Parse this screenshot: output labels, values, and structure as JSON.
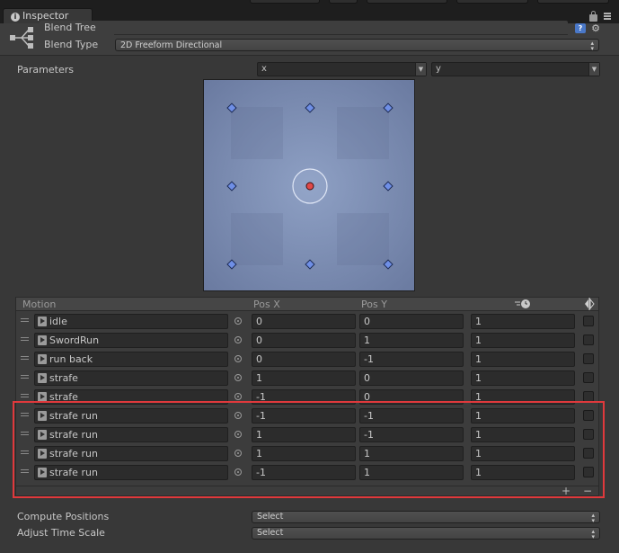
{
  "tab": {
    "title": "Inspector"
  },
  "header": {
    "name_value": "Blend Tree",
    "blend_type_label": "Blend Type",
    "blend_type_value": "2D Freeform Directional"
  },
  "parameters": {
    "label": "Parameters",
    "x_param": "x",
    "y_param": "y"
  },
  "graph": {
    "background": "#7b8aad",
    "points": [
      {
        "x": -1,
        "y": 1
      },
      {
        "x": 0,
        "y": 1
      },
      {
        "x": 1,
        "y": 1
      },
      {
        "x": -1,
        "y": 0
      },
      {
        "x": 1,
        "y": 0
      },
      {
        "x": -1,
        "y": -1
      },
      {
        "x": 0,
        "y": -1
      },
      {
        "x": 1,
        "y": -1
      }
    ],
    "center_point": {
      "x": 0,
      "y": 0
    },
    "point_color": "#6f8fe6",
    "center_color": "#e04848"
  },
  "table": {
    "headers": {
      "motion": "Motion",
      "pos_x": "Pos X",
      "pos_y": "Pos Y"
    },
    "header_icons": {
      "speed": "timescale-icon",
      "mirror": "mirror-icon"
    },
    "rows": [
      {
        "motion": "idle",
        "pos_x": "0",
        "pos_y": "0",
        "speed": "1"
      },
      {
        "motion": "SwordRun",
        "pos_x": "0",
        "pos_y": "1",
        "speed": "1"
      },
      {
        "motion": "run back",
        "pos_x": "0",
        "pos_y": "-1",
        "speed": "1"
      },
      {
        "motion": "strafe",
        "pos_x": "1",
        "pos_y": "0",
        "speed": "1"
      },
      {
        "motion": "strafe",
        "pos_x": "-1",
        "pos_y": "0",
        "speed": "1"
      },
      {
        "motion": "strafe run",
        "pos_x": "-1",
        "pos_y": "-1",
        "speed": "1"
      },
      {
        "motion": "strafe run",
        "pos_x": "1",
        "pos_y": "-1",
        "speed": "1"
      },
      {
        "motion": "strafe run",
        "pos_x": "1",
        "pos_y": "1",
        "speed": "1"
      },
      {
        "motion": "strafe run",
        "pos_x": "-1",
        "pos_y": "1",
        "speed": "1"
      }
    ],
    "add_symbol": "+",
    "remove_symbol": "−"
  },
  "compute_positions": {
    "label": "Compute Positions",
    "value": "Select"
  },
  "adjust_time_scale": {
    "label": "Adjust Time Scale",
    "value": "Select"
  },
  "colors": {
    "highlight": "#e0393c",
    "panel": "#383838"
  }
}
